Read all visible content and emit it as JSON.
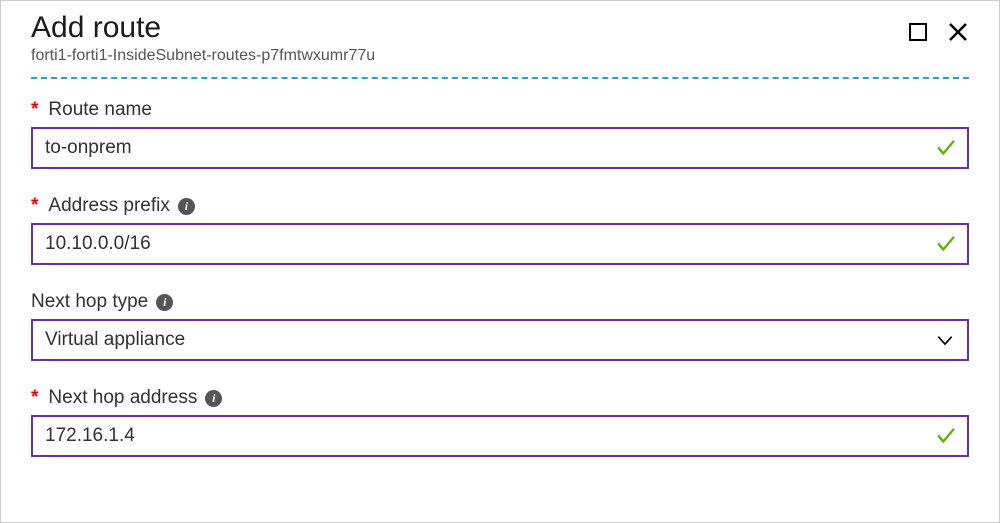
{
  "header": {
    "title": "Add route",
    "subtitle": "forti1-forti1-InsideSubnet-routes-p7fmtwxumr77u"
  },
  "fields": {
    "route_name": {
      "label": "Route name",
      "required": true,
      "value": "to-onprem",
      "has_info": false,
      "validated": true
    },
    "address_prefix": {
      "label": "Address prefix",
      "required": true,
      "value": "10.10.0.0/16",
      "has_info": true,
      "validated": true
    },
    "next_hop_type": {
      "label": "Next hop type",
      "required": false,
      "value": "Virtual appliance",
      "has_info": true,
      "is_select": true
    },
    "next_hop_address": {
      "label": "Next hop address",
      "required": true,
      "value": "172.16.1.4",
      "has_info": true,
      "validated": true
    }
  },
  "icons": {
    "info": "i"
  }
}
